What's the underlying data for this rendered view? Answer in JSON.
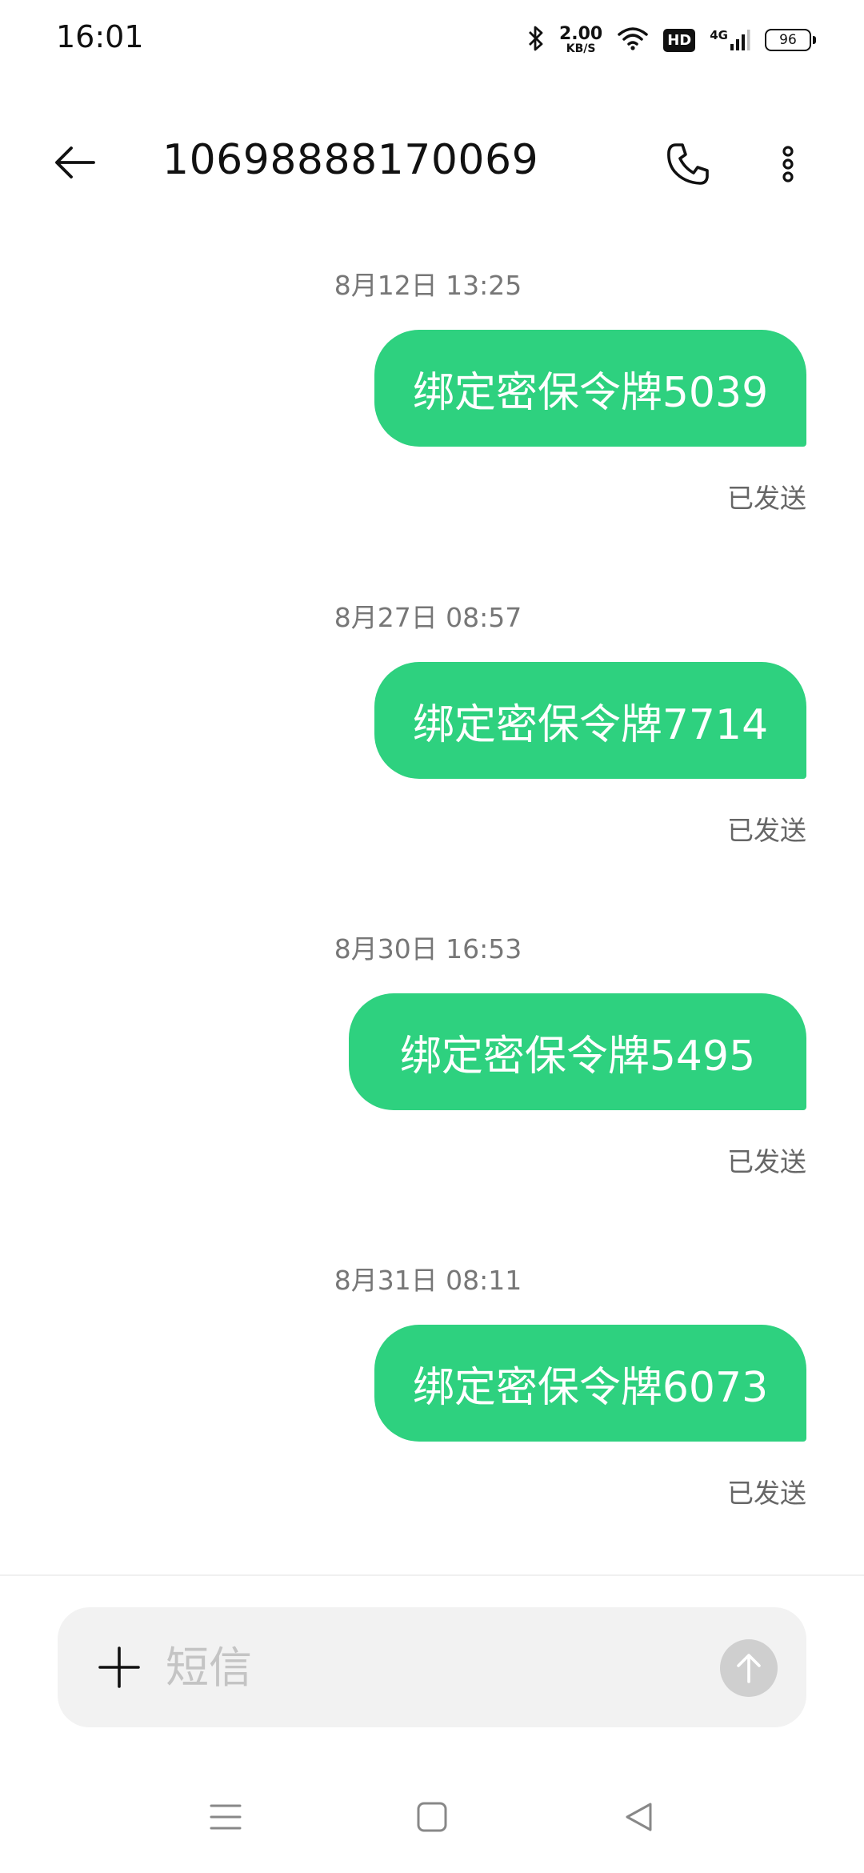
{
  "status_bar": {
    "time": "16:01",
    "net_speed_value": "2.00",
    "net_speed_unit": "KB/S",
    "hd_label": "HD",
    "signal_label": "4G",
    "battery": "96"
  },
  "header": {
    "title": "10698888170069",
    "icons": {
      "back": "back-arrow-icon",
      "call": "phone-icon",
      "more": "more-vertical-icon"
    }
  },
  "messages": [
    {
      "time": "8月12日 13:25",
      "text": "绑定密保令牌5039",
      "status": "已发送"
    },
    {
      "time": "8月27日 08:57",
      "text": "绑定密保令牌7714",
      "status": "已发送"
    },
    {
      "time": "8月30日 16:53",
      "text": "绑定密保令牌5495",
      "status": "已发送"
    },
    {
      "time": "8月31日 08:11",
      "text": "绑定密保令牌6073",
      "status": "已发送"
    }
  ],
  "composer": {
    "placeholder": "短信",
    "value": ""
  },
  "colors": {
    "bubble": "#2ed17f",
    "send_disabled": "#cfcfcf",
    "input_bg": "#f2f2f2"
  }
}
